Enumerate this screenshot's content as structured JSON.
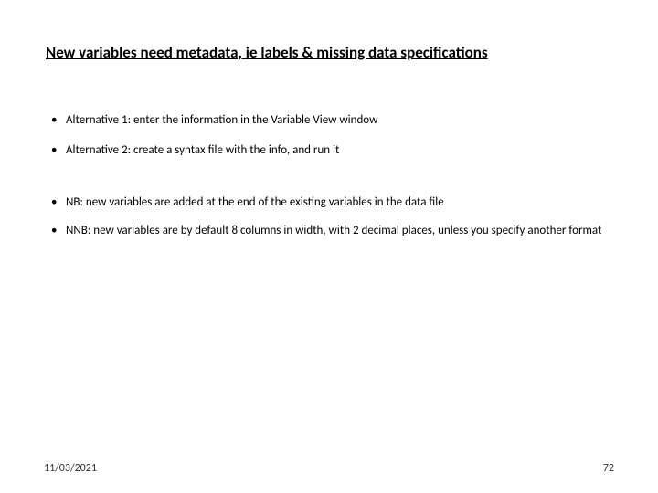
{
  "title": "New variables need metadata, ie labels & missing data specifications",
  "bullets": [
    "Alternative 1: enter the information in the Variable View window",
    "Alternative 2: create a syntax file with the info, and run it",
    "NB: new variables are added at the end of the existing variables in the data file",
    "NNB: new variables are by default 8 columns in width, with 2 decimal places, unless you specify another format"
  ],
  "footer": {
    "date": "11/03/2021",
    "page": "72"
  }
}
